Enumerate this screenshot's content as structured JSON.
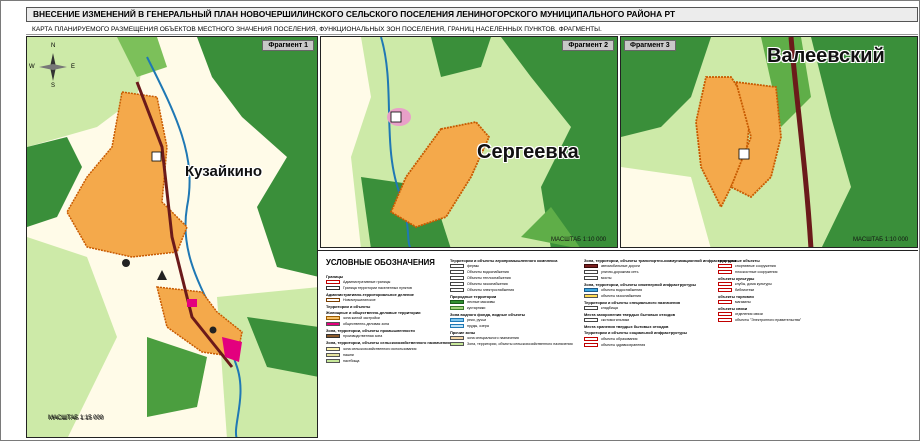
{
  "title": "ВНЕСЕНИЕ ИЗМЕНЕНИЙ В ГЕНЕРАЛЬНЫЙ ПЛАН НОВОЧЕРШИЛИНСКОГО СЕЛЬСКОГО ПОСЕЛЕНИЯ  ЛЕНИНОГОРСКОГО МУНИЦИПАЛЬНОГО РАЙОНА РТ",
  "subtitle": "КАРТА ПЛАНИРУЕМОГО РАЗМЕЩЕНИЯ ОБЪЕКТОВ МЕСТНОГО ЗНАЧЕНИЯ ПОСЕЛЕНИЯ, ФУНКЦИОНАЛЬНЫХ ЗОН ПОСЕЛЕНИЯ, ГРАНИЦ НАСЕЛЕННЫХ ПУНКТОВ. ФРАГМЕНТЫ.",
  "compass": {
    "n": "N",
    "s": "S",
    "w": "W",
    "e": "E"
  },
  "fragments": [
    {
      "label": "Фрагмент 1",
      "place": "Кузайкино",
      "scale": "МАСШТАБ 1:15 000"
    },
    {
      "label": "Фрагмент 2",
      "place": "Сергеевка",
      "scale": "МАСШТАБ 1:10 000"
    },
    {
      "label": "Фрагмент 3",
      "place": "Валеевский",
      "scale": "МАСШТАБ 1:10 000"
    }
  ],
  "legend": {
    "title": "УСЛОВНЫЕ ОБОЗНАЧЕНИЯ",
    "col1": [
      {
        "type": "head",
        "text": "Границы"
      },
      {
        "type": "item",
        "text": "Административные границы",
        "color": "#ffffff",
        "border": "#c00000"
      },
      {
        "type": "item",
        "text": "Граница территории населенных пунктов",
        "color": "#ffffff",
        "border": "#333333"
      },
      {
        "type": "head",
        "text": "Административно-территориальное деление"
      },
      {
        "type": "item",
        "text": "Новочершилинское",
        "color": "#ffffff",
        "border": "#7a3d00"
      },
      {
        "type": "head",
        "text": "Территории и объекты"
      },
      {
        "type": "head",
        "text": "Жилищные и общественно-деловые территории"
      },
      {
        "type": "item",
        "text": "зона жилой застройки",
        "color": "#f6c26b",
        "border": "#9a5b00"
      },
      {
        "type": "item",
        "text": "общественно-деловая зона",
        "color": "#e3007e",
        "border": "#555555"
      },
      {
        "type": "head",
        "text": "Зона, территории, объекты промышленности"
      },
      {
        "type": "item",
        "text": "производственная зона",
        "color": "#8b5a2b",
        "border": "#333333"
      },
      {
        "type": "head",
        "text": "Зона, территории, объекты сельскохозяйственного назначения"
      },
      {
        "type": "item",
        "text": "зона сельскохозяйственного использования",
        "color": "#fff7b0",
        "border": "#555555"
      },
      {
        "type": "item",
        "text": "пашни",
        "color": "#e7e4a0",
        "border": "#555555"
      },
      {
        "type": "item",
        "text": "пастбища",
        "color": "#c7e89a",
        "border": "#555555"
      }
    ],
    "col2": [
      {
        "type": "head",
        "text": "Территории и объекты агропромышленного комплекса"
      },
      {
        "type": "item",
        "text": "фермы",
        "color": "#ffffff",
        "border": "#444444"
      },
      {
        "type": "item",
        "text": "Объекты водоснабжения",
        "color": "#ffffff",
        "border": "#444444"
      },
      {
        "type": "item",
        "text": "Объекты теплоснабжения",
        "color": "#ffffff",
        "border": "#444444"
      },
      {
        "type": "item",
        "text": "Объекты газоснабжения",
        "color": "#ffffff",
        "border": "#444444"
      },
      {
        "type": "item",
        "text": "Объекты электроснабжения",
        "color": "#ffffff",
        "border": "#444444"
      },
      {
        "type": "head",
        "text": "Природные территории"
      },
      {
        "type": "item",
        "text": "лесные массивы",
        "color": "#2f8f2f",
        "border": "#1a5a1a"
      },
      {
        "type": "item",
        "text": "кустарники",
        "color": "#9fd37a",
        "border": "#3a7a2a"
      },
      {
        "type": "head",
        "text": "Зона водного фонда, водные объекты"
      },
      {
        "type": "item",
        "text": "реки, ручьи",
        "color": "#7fc6ee",
        "border": "#1f78b4"
      },
      {
        "type": "item",
        "text": "пруды, озера",
        "color": "#bfe3f7",
        "border": "#1f78b4"
      },
      {
        "type": "head",
        "text": "Прочие зоны"
      },
      {
        "type": "item",
        "text": "зона специального назначения",
        "color": "#f4d7a8",
        "border": "#555555"
      },
      {
        "type": "item",
        "text": "Зона, территории, объекты сельскохозяйственного назначения",
        "color": "#c7e89a",
        "border": "#555555"
      }
    ],
    "col3": [
      {
        "type": "head",
        "text": "Зона, территории, объекты транспортно-коммуникационной инфраструктуры"
      },
      {
        "type": "item",
        "text": "автомобильные дороги",
        "color": "#7a1f1f",
        "border": "#3a0a0a"
      },
      {
        "type": "item",
        "text": "улично-дорожная сеть",
        "color": "#ffffff",
        "border": "#444444"
      },
      {
        "type": "item",
        "text": "мосты",
        "color": "#ffffff",
        "border": "#444444"
      },
      {
        "type": "head",
        "text": "Зона, территории, объекты инженерной инфраструктуры"
      },
      {
        "type": "item",
        "text": "объекты водоснабжения",
        "color": "#3fa9e0",
        "border": "#1a5a8a"
      },
      {
        "type": "item",
        "text": "объекты газоснабжения",
        "color": "#ffdd55",
        "border": "#555555"
      },
      {
        "type": "head",
        "text": "Территории и объекты специального назначения"
      },
      {
        "type": "item",
        "text": "кладбища",
        "color": "#ffffff",
        "border": "#444444"
      },
      {
        "type": "head",
        "text": "Места захоронения твердых бытовых отходов"
      },
      {
        "type": "item",
        "text": "скотомогильники",
        "color": "#ffffff",
        "border": "#444444"
      },
      {
        "type": "head",
        "text": "Места хранения твердых бытовых отходов"
      },
      {
        "type": "head",
        "text": "Территории и объекты социальной инфраструктуры"
      },
      {
        "type": "item",
        "text": "объекты образования",
        "color": "#ffffff",
        "border": "#c00000"
      },
      {
        "type": "item",
        "text": "объекты здравоохранения",
        "color": "#ffffff",
        "border": "#c00000"
      }
    ],
    "col4": [
      {
        "type": "head",
        "text": "спортивные объекты"
      },
      {
        "type": "item",
        "text": "спортивные сооружения",
        "color": "#ffffff",
        "border": "#c00000"
      },
      {
        "type": "item",
        "text": "плоскостные сооружения",
        "color": "#ffffff",
        "border": "#c00000"
      },
      {
        "type": "head",
        "text": "объекты культуры"
      },
      {
        "type": "item",
        "text": "клубы, дома культуры",
        "color": "#ffffff",
        "border": "#c00000"
      },
      {
        "type": "item",
        "text": "библиотеки",
        "color": "#ffffff",
        "border": "#c00000"
      },
      {
        "type": "head",
        "text": "объекты торговли"
      },
      {
        "type": "item",
        "text": "магазины",
        "color": "#ffffff",
        "border": "#c00000"
      },
      {
        "type": "head",
        "text": "объекты связи"
      },
      {
        "type": "item",
        "text": "отделения связи",
        "color": "#ffffff",
        "border": "#c00000"
      },
      {
        "type": "item",
        "text": "объекты \"Электронного правительства\"",
        "color": "#ffffff",
        "border": "#c00000"
      }
    ]
  },
  "main_scale": "МАСШТАБ 1:15 000",
  "colors": {
    "forest": "#3a8f3a",
    "meadow": "#cdeaa8",
    "field": "#fffbe8",
    "residential": "#f4a94b",
    "boundary": "#c85a00",
    "river": "#1f78b4",
    "road": "#6b1a1a"
  }
}
